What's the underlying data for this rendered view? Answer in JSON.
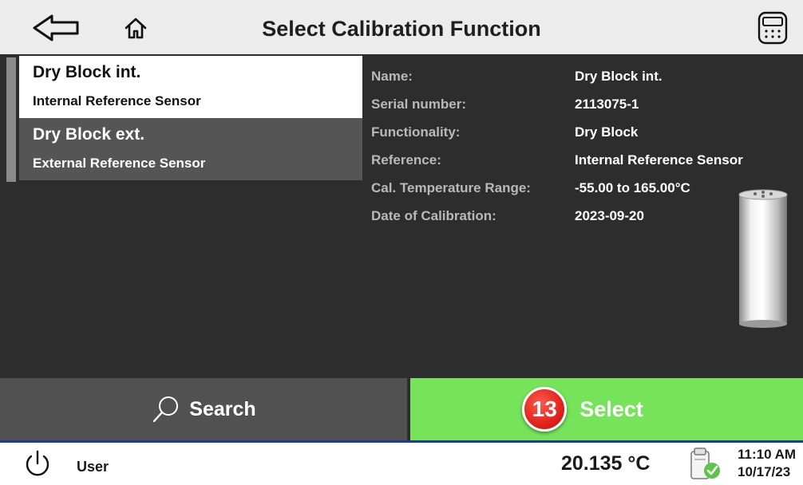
{
  "header": {
    "title": "Select Calibration Function"
  },
  "list": {
    "items": [
      {
        "title": "Dry Block int.",
        "subtitle": "Internal Reference Sensor"
      },
      {
        "title": "Dry Block ext.",
        "subtitle": "External Reference Sensor"
      }
    ]
  },
  "details": {
    "rows": [
      {
        "label": "Name:",
        "value": "Dry Block int."
      },
      {
        "label": "Serial number:",
        "value": "2113075-1"
      },
      {
        "label": "Functionality:",
        "value": "Dry Block"
      },
      {
        "label": "Reference:",
        "value": "Internal Reference Sensor"
      },
      {
        "label": "Cal. Temperature Range:",
        "value": "-55.00 to 165.00°C"
      },
      {
        "label": "Date of Calibration:",
        "value": "2023-09-20"
      }
    ]
  },
  "actions": {
    "search_label": "Search",
    "select_label": "Select",
    "select_badge": "13"
  },
  "status": {
    "user": "User",
    "temperature": "20.135 °C",
    "time": "11:10 AM",
    "date": "10/17/23"
  },
  "icons": {
    "back": "back-arrow-icon",
    "home": "home-icon",
    "calculator": "calculator-icon",
    "search": "search-icon",
    "power": "power-icon",
    "device": "device-ok-icon"
  },
  "colors": {
    "select_green": "#76e35b",
    "badge_red": "#e2231a",
    "panel_dark": "#2d2d2d",
    "status_line": "#1a3a9c"
  }
}
